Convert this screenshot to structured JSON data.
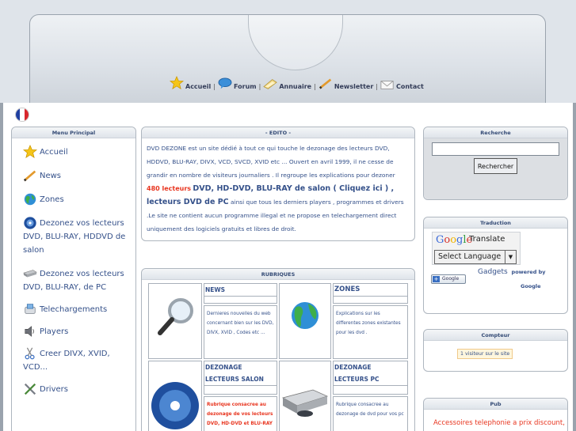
{
  "header": {
    "nav": [
      {
        "label": "Accueil",
        "icon": "star-icon"
      },
      {
        "label": "Forum",
        "icon": "speech-bubble-icon"
      },
      {
        "label": "Annuaire",
        "icon": "folder-icon"
      },
      {
        "label": "Newsletter",
        "icon": "pencil-icon"
      },
      {
        "label": "Contact",
        "icon": "envelope-icon"
      }
    ],
    "separator": "|"
  },
  "language_flag": "french-flag-icon",
  "menu": {
    "title": "Menu Principal",
    "items": [
      {
        "label": "Accueil",
        "icon": "star-icon"
      },
      {
        "label": "News",
        "icon": "pencil-icon"
      },
      {
        "label": "Zones",
        "icon": "globe-icon"
      },
      {
        "label": "Dezonez vos lecteurs DVD, BLU-RAY, HDDVD de salon",
        "icon": "disc-icon"
      },
      {
        "label": "Dezonez vos lecteurs DVD, BLU-RAY, de PC",
        "icon": "dvd-drive-icon"
      },
      {
        "label": "Telechargements",
        "icon": "download-icon"
      },
      {
        "label": "Players",
        "icon": "speaker-icon"
      },
      {
        "label": "Creer DIVX, XVID, VCD...",
        "icon": "scissors-icon"
      },
      {
        "label": "Drivers",
        "icon": "tools-icon"
      }
    ]
  },
  "edito": {
    "title": "- EDITO -",
    "p1": "DVD DEZONE est un site dédié à tout ce qui touche le dezonage des lecteurs DVD, HDDVD, BLU-RAY, DIVX, VCD, SVCD, XVID etc ... Ouvert en avril 1999, il ne cesse de grandir en nombre de visiteurs journaliers . Il regroupe les explications pour dezoner",
    "red": "480 lecteurs",
    "big1": "DVD, HD-DVD, BLU-RAY de salon ( Cliquez ici ) , lecteurs DVD de PC",
    "p2": "ainsi que tous les derniers players , programmes et drivers .Le site ne contient aucun programme illegal et ne propose en telechargement direct uniquement des logiciels gratuits et libres de droit."
  },
  "rubriques": {
    "title": "RUBRIQUES",
    "news": {
      "title": "NEWS",
      "desc": "Dernieres nouvelles du web concernant bien sur les DVD, DIVX, XVID , Codes etc ...",
      "icon": "magnifier-icon"
    },
    "zones": {
      "title": "ZONES",
      "desc": "Explications sur les differentes zones existantes pour les dvd .",
      "icon": "globe-icon"
    },
    "salon": {
      "title": "DEZONAGE LECTEURS SALON",
      "desc": "Rubrique consacree au dezonage de vos lecteurs DVD, HD-DVD et BLU-RAY",
      "icon": "dvd-disc-icon"
    },
    "pc": {
      "title": "DEZONAGE LECTEURS PC",
      "desc": "Rubrique consacree au dezonage de dvd pour vos pc",
      "icon": "dvd-drive-icon"
    }
  },
  "recherche": {
    "title": "Recherche",
    "button": "Rechercher",
    "value": ""
  },
  "traduction": {
    "title": "Traduction",
    "google": "Google",
    "translate": "Translate",
    "select": "Select Language",
    "gadgets": "Gadgets",
    "powered": "powered by",
    "google2": "Google",
    "add_btn": "Google"
  },
  "compteur": {
    "title": "Compteur",
    "text": "1 visiteur sur le site"
  },
  "pub": {
    "title": "Pub",
    "text": "Accessoires telephonie a prix discount,"
  },
  "colors": {
    "link": "#35518a",
    "accent_red": "#e8351f",
    "panel_border": "#aeb6bf"
  }
}
